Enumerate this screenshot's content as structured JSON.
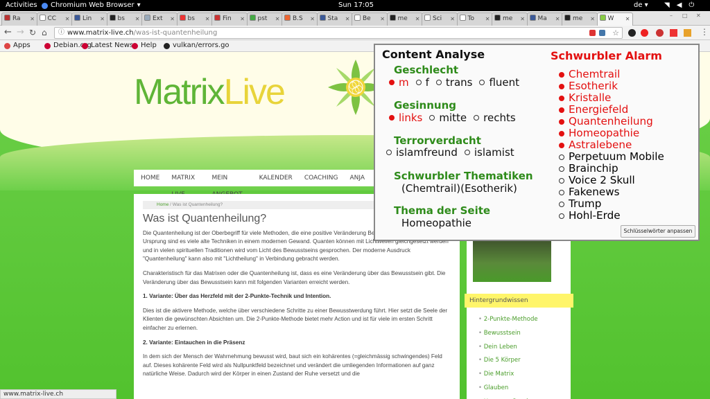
{
  "topbar": {
    "activities": "Activities",
    "app": "Chromium Web Browser",
    "clock": "Sun 17:05",
    "lang": "de"
  },
  "tabs": [
    {
      "label": "Ra",
      "color": "#b33"
    },
    {
      "label": "CC",
      "color": "#fff"
    },
    {
      "label": "Lin",
      "color": "#3b5998"
    },
    {
      "label": "bs",
      "color": "#222"
    },
    {
      "label": "Ext",
      "color": "#9ab"
    },
    {
      "label": "bs",
      "color": "#e33"
    },
    {
      "label": "Fin",
      "color": "#c33"
    },
    {
      "label": "pst",
      "color": "#4a4"
    },
    {
      "label": "B.S",
      "color": "#e63"
    },
    {
      "label": "Sta",
      "color": "#3b5998"
    },
    {
      "label": "Be",
      "color": "#fff"
    },
    {
      "label": "me",
      "color": "#222"
    },
    {
      "label": "Sci",
      "color": "#fff"
    },
    {
      "label": "To",
      "color": "#fff"
    },
    {
      "label": "me",
      "color": "#222"
    },
    {
      "label": "Ma",
      "color": "#3b5998"
    },
    {
      "label": "me",
      "color": "#222"
    },
    {
      "label": "W",
      "color": "#8c4"
    }
  ],
  "address": {
    "host": "www.matrix-live.ch",
    "path": "/was-ist-quantenheilung"
  },
  "bookmarks": [
    {
      "label": "Apps",
      "color": "#d44"
    },
    {
      "label": "Debian.org",
      "color": "#c03"
    },
    {
      "label": "Latest News",
      "color": "#c03"
    },
    {
      "label": "Help",
      "color": "#c03"
    },
    {
      "label": "vulkan/errors.go",
      "color": "#222"
    }
  ],
  "site": {
    "logo_a": "Matrix",
    "logo_b": "Live",
    "menu": [
      "HOME",
      "MATRIX LIVE",
      "MEIN ANGEBOT",
      "KALENDER",
      "COACHING",
      "ANJA"
    ],
    "crumb_home": "Home",
    "crumb_current": "Was ist Quantenheilung?",
    "title": "Was ist Quantenheilung?",
    "p1": "Die Quantenheilung ist der Oberbegriff für viele Methoden, die eine positive Veränderung Bewusstsein herbeiführen. Im Ursprung sind es viele alte Techniken in einem modernen Gewand. Quanten können mit Lichtwellen gleichgesetzt werden und in vielen spirituellen Traditionen wird vom Licht des Bewusstseins gesprochen. Der moderne Ausdruck \"Quantenheilung\" kann also mit \"Lichtheilung\" in Verbindung gebracht werden.",
    "p2": "Charakteristisch für das Matrixen oder die Quantenheilung ist, dass es eine Veränderung über das Bewusstsein gibt. Die Veränderung über das Bewusstsein kann mit folgenden Varianten erreicht werden.",
    "v1": "1. Variante: Über das Herzfeld mit der 2-Punkte-Technik und Intention.",
    "p3": "Dies ist die aktivere Methode, welche über verschiedene Schritte zu einer Bewusstwerdung führt. Hier setzt die Seele der Klienten die gewünschten Absichten um. Die 2-Punkte-Methode bietet mehr Action und ist für viele im ersten Schritt einfacher zu erlernen.",
    "v2": "2. Variante: Eintauchen in die Präsenz",
    "p4": "In dem sich der Mensch der Wahrnehmung bewusst wird, baut sich ein kohärentes (=gleichmässig schwingendes) Feld auf. Dieses kohärente Feld wird als Nullpunktfeld bezeichnet und verändert die umliegenden Informationen auf ganz natürliche Weise. Dadurch wird der Körper in einen Zustand der Ruhe versetzt und die",
    "side_head": "Hintergrundwissen",
    "side_items": [
      "2-Punkte-Methode",
      "Bewusstsein",
      "Dein Leben",
      "Die 5 Körper",
      "Die Matrix",
      "Glauben",
      "Herzenswünsche"
    ]
  },
  "status": "www.matrix-live.ch",
  "popup": {
    "title": "Content Analyse",
    "alarm_title": "Schwurbler Alarm",
    "gender_label": "Geschlecht",
    "gender": [
      {
        "label": "m",
        "on": true
      },
      {
        "label": "f",
        "on": false
      },
      {
        "label": "trans",
        "on": false
      },
      {
        "label": "fluent",
        "on": false
      }
    ],
    "attitude_label": "Gesinnung",
    "attitude": [
      {
        "label": "links",
        "on": true
      },
      {
        "label": "mitte",
        "on": false
      },
      {
        "label": "rechts",
        "on": false
      }
    ],
    "terror_label": "Terrorverdacht",
    "terror": [
      {
        "label": "islamfreund",
        "on": false
      },
      {
        "label": "islamist",
        "on": false
      }
    ],
    "topics_label": "Schwurbler Thematiken",
    "topics": "(Chemtrail)(Esotherik)",
    "theme_label": "Thema der Seite",
    "theme": "Homeopathie",
    "alarm": [
      {
        "label": "Chemtrail",
        "on": true
      },
      {
        "label": "Esotherik",
        "on": true
      },
      {
        "label": "Kristalle",
        "on": true
      },
      {
        "label": "Energiefeld",
        "on": true
      },
      {
        "label": "Quantenheilung",
        "on": true
      },
      {
        "label": "Homeopathie",
        "on": true
      },
      {
        "label": "Astralebene",
        "on": true
      },
      {
        "label": "Perpetuum Mobile",
        "on": false
      },
      {
        "label": "Brainchip",
        "on": false
      },
      {
        "label": "Voice 2 Skull",
        "on": false
      },
      {
        "label": "Fakenews",
        "on": false
      },
      {
        "label": "Trump",
        "on": false
      },
      {
        "label": "Hohl-Erde",
        "on": false
      }
    ],
    "button": "Schlüsselwörter anpassen"
  }
}
